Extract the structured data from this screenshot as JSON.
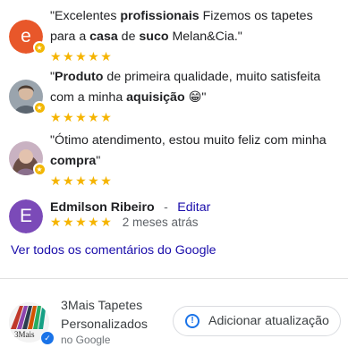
{
  "reviews": [
    {
      "avatar_letter": "e",
      "avatar_color": "#e8572a",
      "parts": [
        {
          "t": "\"Excelentes "
        },
        {
          "t": "profissionais",
          "b": true
        },
        {
          "t": " Fizemos os tapetes para a "
        },
        {
          "t": "casa",
          "b": true
        },
        {
          "t": " de "
        },
        {
          "t": "suco",
          "b": true
        },
        {
          "t": " Melan&Cia.\""
        }
      ],
      "stars": "★★★★★"
    },
    {
      "avatar_letter": "",
      "avatar_color": "#8e9aa7",
      "parts": [
        {
          "t": "\""
        },
        {
          "t": "Produto",
          "b": true
        },
        {
          "t": " de primeira qualidade, muito satisfeita com a minha "
        },
        {
          "t": "aquisição",
          "b": true
        },
        {
          "t": " 😁\""
        }
      ],
      "stars": "★★★★★"
    },
    {
      "avatar_letter": "",
      "avatar_color": "#b58aa0",
      "parts": [
        {
          "t": "\"Ótimo atendimento, estou muito feliz com minha "
        },
        {
          "t": "compra",
          "b": true
        },
        {
          "t": "\""
        }
      ],
      "stars": "★★★★★"
    }
  ],
  "own_review": {
    "avatar_letter": "E",
    "avatar_color": "#7b4ab8",
    "name": "Edmilson Ribeiro",
    "separator": "-",
    "edit_label": "Editar",
    "stars": "★★★★★",
    "time_ago": "2 meses atrás"
  },
  "all_reviews_link": "Ver todos os comentários do Google",
  "business": {
    "logo_text": "3Mais",
    "name": "3Mais Tapetes Personalizados",
    "source": "no Google",
    "update_button": "Adicionar atualização",
    "update_icon": "clock-update-icon"
  }
}
